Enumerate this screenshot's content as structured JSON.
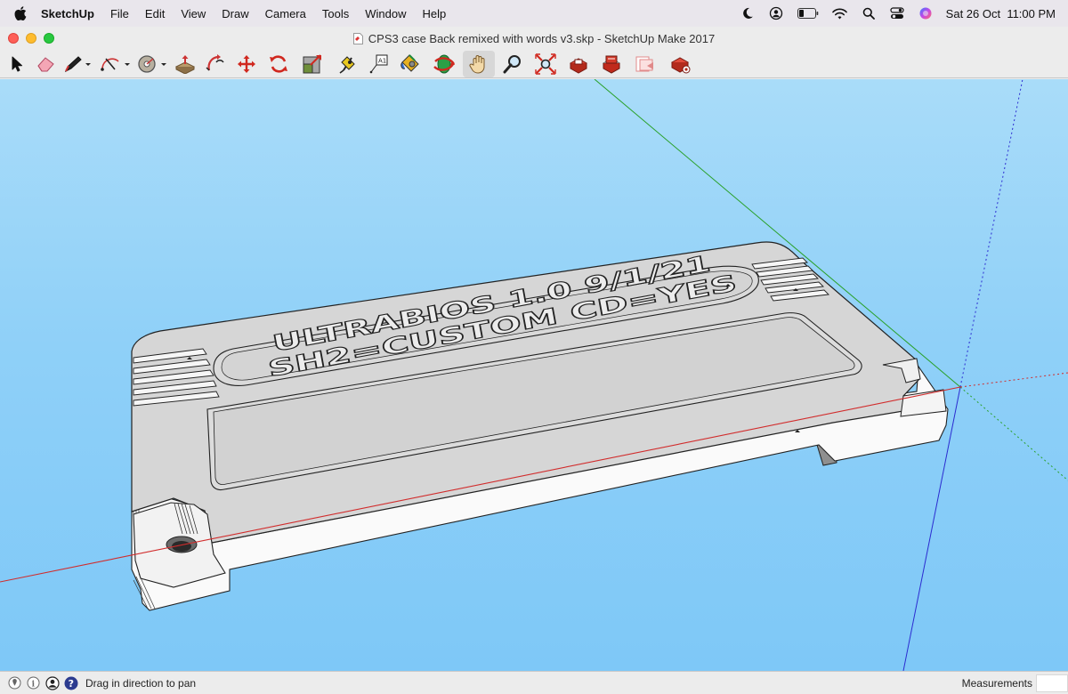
{
  "menubar": {
    "app_name": "SketchUp",
    "items": [
      "File",
      "Edit",
      "View",
      "Draw",
      "Camera",
      "Tools",
      "Window",
      "Help"
    ],
    "clock": "Sat 26 Oct  11:00 PM"
  },
  "window": {
    "title": "CPS3 case Back remixed with words v3.skp - SketchUp Make 2017"
  },
  "toolbar": {
    "tools": [
      "select",
      "eraser",
      "pencil",
      "arc",
      "shapes",
      "push-pull",
      "follow-me",
      "move",
      "rotate",
      "scale",
      "tape-measure",
      "text",
      "paint-bucket",
      "orbit",
      "pan",
      "zoom",
      "zoom-extents",
      "3d-warehouse",
      "extension-warehouse",
      "layout",
      "extension-manager"
    ],
    "active_tool": "pan"
  },
  "model": {
    "engraved_line_1": "ULTRABIOS 1.0 9/1/21",
    "engraved_line_2": "SH2=CUSTOM  CD=YES"
  },
  "statusbar": {
    "hint": "Drag in direction to pan",
    "measurements_label": "Measurements",
    "measurements_value": ""
  },
  "colors": {
    "sky": "#8fd0f8",
    "model_top": "#d4d4d4",
    "model_side": "#ffffff",
    "red_axis": "#d12c2c",
    "green_axis": "#2aa12a",
    "blue_axis": "#2b2bd0"
  }
}
